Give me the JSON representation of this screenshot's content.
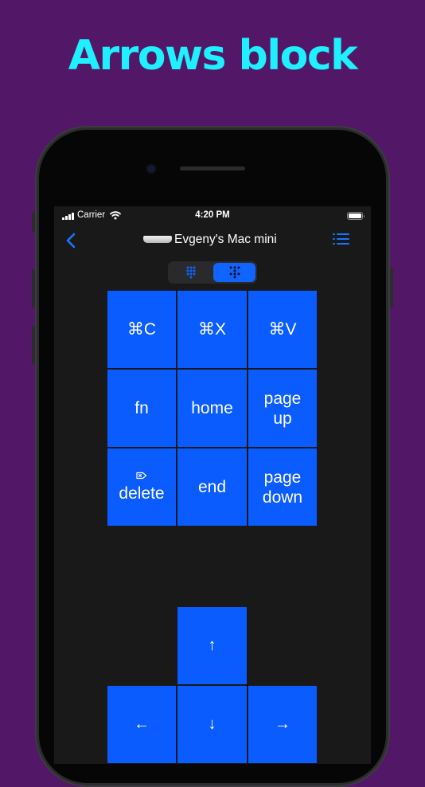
{
  "headline": "Arrows block",
  "status_bar": {
    "carrier": "Carrier",
    "time": "4:20 PM"
  },
  "nav": {
    "title": "Evgeny's Mac mini"
  },
  "segmented": {
    "selected_index": 1,
    "icons": [
      "keypad-grid-icon",
      "arrows-keypad-icon"
    ]
  },
  "keys": [
    {
      "label": "⌘C"
    },
    {
      "label": "⌘X"
    },
    {
      "label": "⌘V"
    },
    {
      "label": "fn"
    },
    {
      "label": "home"
    },
    {
      "label": "page\nup"
    },
    {
      "label": "delete"
    },
    {
      "label": "end"
    },
    {
      "label": "page\ndown"
    }
  ],
  "arrows": {
    "up": "↑",
    "left": "←",
    "down": "↓",
    "right": "→"
  },
  "colors": {
    "background": "#521766",
    "headline": "#1ff0ff",
    "key": "#0a5cff",
    "accent": "#1976ff",
    "screen": "#191919"
  }
}
